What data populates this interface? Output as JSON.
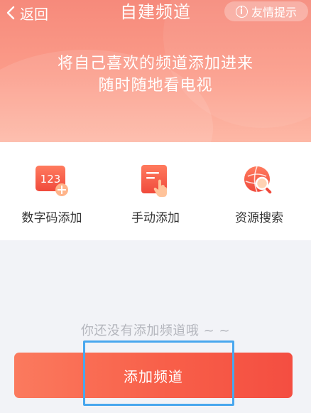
{
  "header": {
    "back_label": "返回",
    "title": "自建频道",
    "tips_label": "友情提示",
    "slogan_line1": "将自己喜欢的频道添加进来",
    "slogan_line2": "随时随地看电视"
  },
  "options": [
    {
      "label": "数字码添加",
      "icon": "number-code-icon",
      "icon_text": "123"
    },
    {
      "label": "手动添加",
      "icon": "manual-add-icon"
    },
    {
      "label": "资源搜索",
      "icon": "resource-search-icon"
    }
  ],
  "empty": {
    "message": "你还没有添加频道哦 ~ ~"
  },
  "add_button": {
    "label": "添加频道"
  },
  "colors": {
    "header_top": "#f68a7b",
    "accent": "#f85f49",
    "highlight": "#49a7ee",
    "background": "#f2f3f7"
  }
}
